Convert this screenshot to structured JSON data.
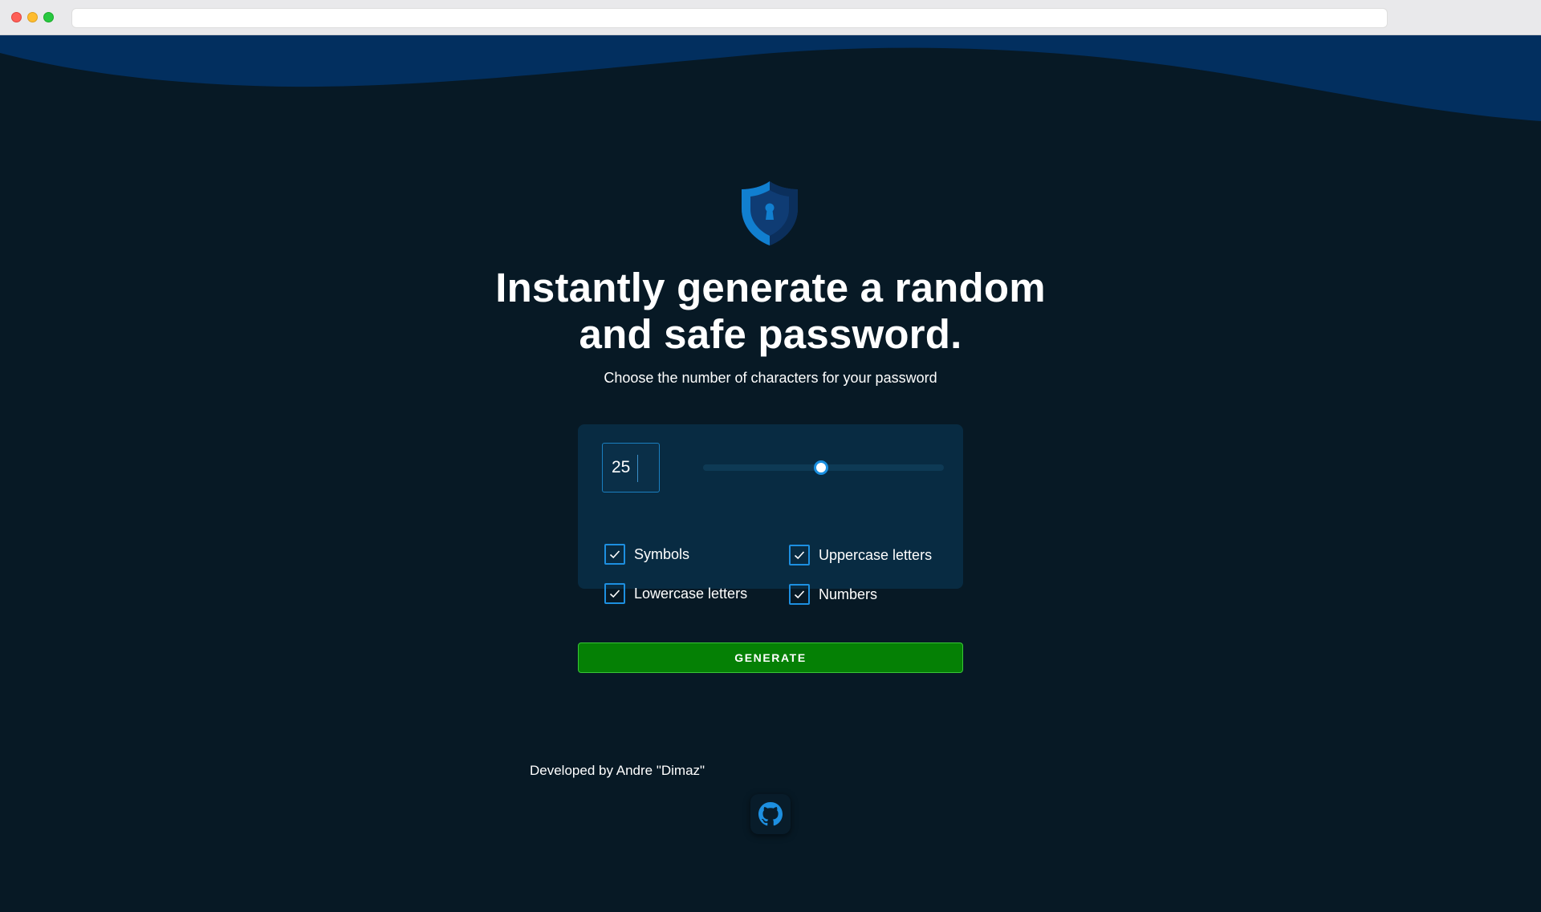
{
  "browser": {
    "url": ""
  },
  "hero": {
    "logo_icon": "shield-lock-icon",
    "headline_line1": "Instantly generate a random",
    "headline_line2": "and safe password.",
    "subtitle": "Choose the number of characters for your password"
  },
  "generator": {
    "length_value": "25",
    "slider_level_fraction": 0.49,
    "options": {
      "symbols": {
        "label": "Symbols",
        "checked": true
      },
      "uppercase": {
        "label": "Uppercase letters",
        "checked": true
      },
      "lowercase": {
        "label": "Lowercase letters",
        "checked": true
      },
      "numbers": {
        "label": "Numbers",
        "checked": true
      }
    },
    "generate_label": "GENERATE"
  },
  "footer": {
    "credit": "Developed by Andre \"Dimaz\"",
    "github_icon": "github-icon"
  },
  "colors": {
    "background": "#071925",
    "wave": "#022f5f",
    "card": "#082b42",
    "accent": "#1d8fe0",
    "button": "#058005"
  }
}
